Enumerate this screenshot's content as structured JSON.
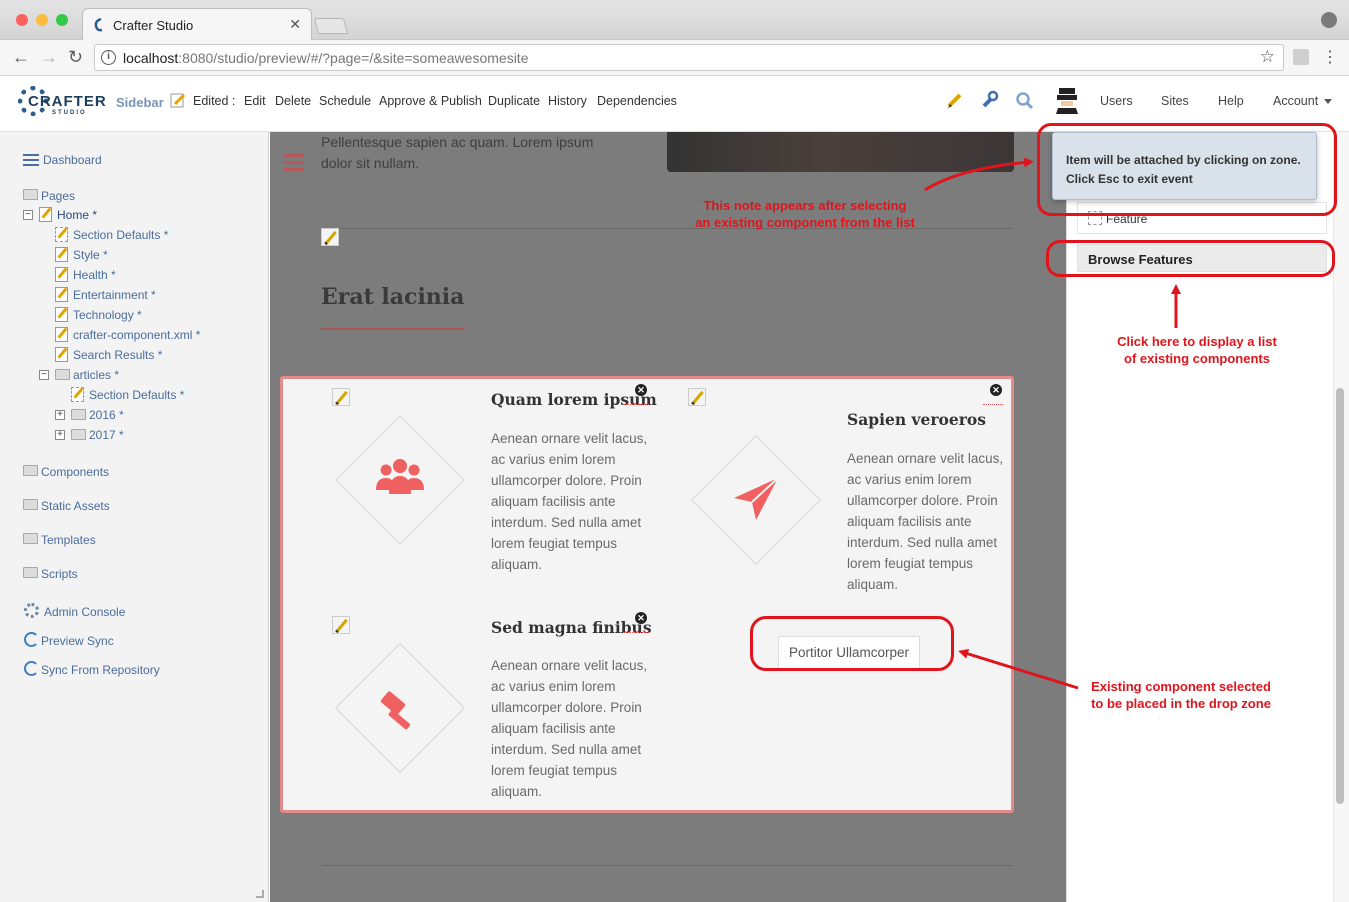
{
  "browser": {
    "tab_title": "Crafter Studio",
    "tab_close": "✕",
    "url_host": "localhost",
    "url_rest": ":8080/studio/preview/#/?page=/&site=someawesomesite",
    "back": "←",
    "forward": "→",
    "reload": "↻",
    "star": "☆",
    "menu": "⋮"
  },
  "toolbar": {
    "logo_text": "CRAFTER",
    "logo_sub": "STUDIO",
    "sidebar_label": "Sidebar",
    "edited_label": "Edited :",
    "actions": [
      "Edit",
      "Delete",
      "Schedule",
      "Approve & Publish",
      "Duplicate",
      "History",
      "Dependencies"
    ],
    "users": "Users",
    "sites": "Sites",
    "help": "Help",
    "account": "Account"
  },
  "sidebar": {
    "dashboard": "Dashboard",
    "pages": "Pages",
    "home": "Home *",
    "home_children": [
      "Section Defaults *",
      "Style *",
      "Health *",
      "Entertainment *",
      "Technology *",
      "crafter-component.xml *",
      "Search Results *"
    ],
    "articles": "articles *",
    "articles_children": [
      "Section Defaults *",
      "2016 *",
      "2017 *"
    ],
    "components": "Components",
    "static_assets": "Static Assets",
    "templates": "Templates",
    "scripts": "Scripts",
    "admin_console": "Admin Console",
    "preview_sync": "Preview Sync",
    "sync_repo": "Sync From Repository"
  },
  "preview": {
    "intro_line1": "Pellentesque sapien ac quam. Lorem ipsum",
    "intro_line2": "dolor sit nullam.",
    "section_title": "Erat lacinia",
    "features": [
      {
        "title": "Quam lorem ipsum",
        "body": "Aenean ornare velit lacus, ac varius enim lorem ullamcorper dolore. Proin aliquam facilisis ante interdum. Sed nulla amet lorem feugiat tempus aliquam.",
        "icon": "users-icon"
      },
      {
        "title": "Sapien veroeros",
        "body": "Aenean ornare velit lacus, ac varius enim lorem ullamcorper dolore. Proin aliquam facilisis ante interdum. Sed nulla amet lorem feugiat tempus aliquam.",
        "icon": "paper-plane-icon"
      },
      {
        "title": "Sed magna finibus",
        "body": "Aenean ornare velit lacus, ac varius enim lorem ullamcorper dolore. Proin aliquam facilisis ante interdum. Sed nulla amet lorem feugiat tempus aliquam.",
        "icon": "gavel-icon"
      }
    ],
    "dropped_component": "Portitor Ullamcorper",
    "remove_glyph": "✕"
  },
  "right_panel": {
    "tooltip_line1": "Item will be attached by clicking on zone.",
    "tooltip_line2": "Click Esc to exit event",
    "feature_item": "Feature",
    "browse_button": "Browse Features"
  },
  "annotations": {
    "note1_line1": "This note appears after selecting",
    "note1_line2": "an existing component from the list",
    "note2_line1": "Click here to display a list",
    "note2_line2": "of existing components",
    "note3_line1": "Existing component selected",
    "note3_line2": "to be placed in the drop zone"
  },
  "colors": {
    "annotation_red": "#e0151c",
    "accent_icon": "#f06060",
    "sidebar_link": "#4a6d9c"
  }
}
